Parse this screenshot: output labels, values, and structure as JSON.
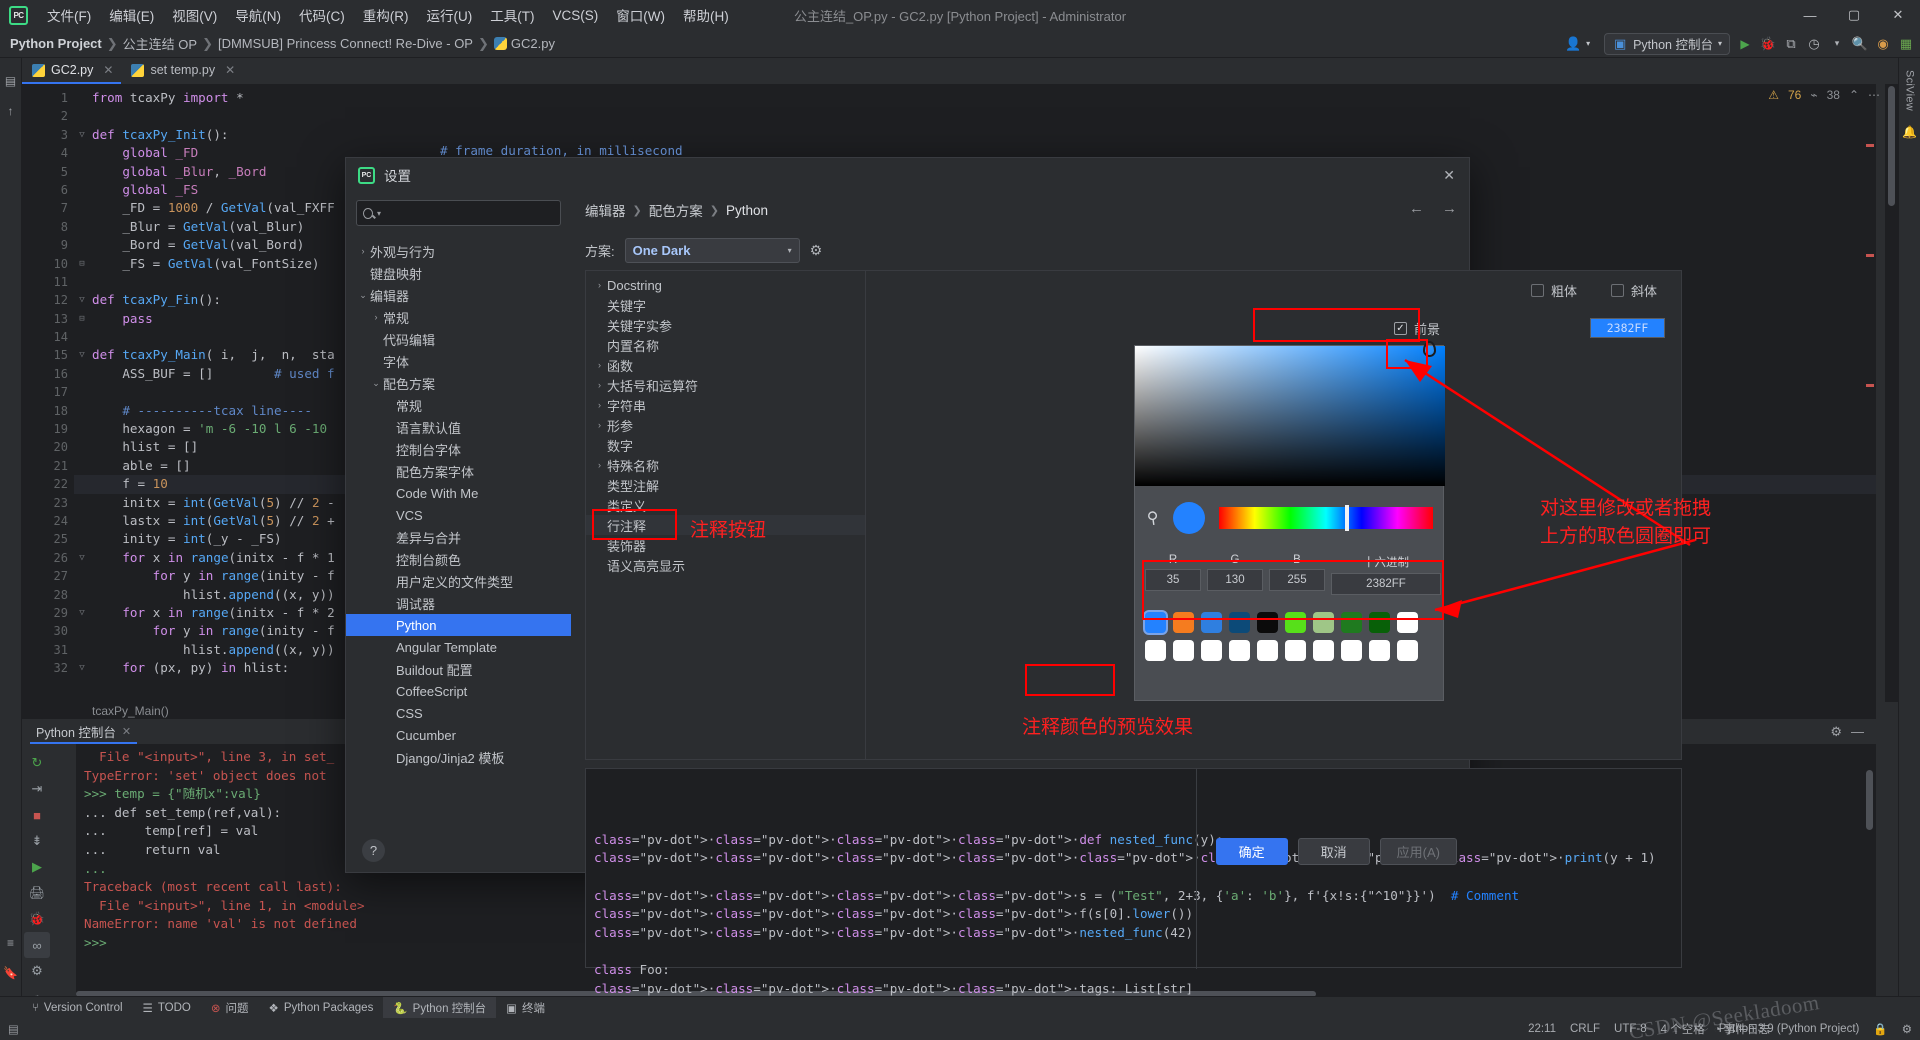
{
  "titlebar": {
    "logo": "PC",
    "menu": [
      "文件(F)",
      "编辑(E)",
      "视图(V)",
      "导航(N)",
      "代码(C)",
      "重构(R)",
      "运行(U)",
      "工具(T)",
      "VCS(S)",
      "窗口(W)",
      "帮助(H)"
    ],
    "window_title": "公主连结_OP.py - GC2.py [Python Project] - Administrator",
    "minimize": "—",
    "maximize": "▢",
    "close": "✕"
  },
  "navbar": {
    "crumbs": [
      "Python Project",
      "公主连结 OP",
      "[DMMSUB] Princess Connect! Re-Dive - OP",
      "GC2.py"
    ],
    "run_config": "Python 控制台",
    "icons": [
      "user-icon",
      "git-branch-icon",
      "run-icon",
      "debug-icon",
      "coverage-icon",
      "profile-icon",
      "search-icon",
      "notification-icon",
      "more-icon"
    ]
  },
  "editor_tabs": [
    {
      "label": "GC2.py",
      "active": true
    },
    {
      "label": "set temp.py",
      "active": false
    }
  ],
  "editor": {
    "badges": {
      "warnings": "76",
      "weak": "38"
    },
    "breadcrumb": "tcaxPy_Main()",
    "lines": [
      {
        "n": 1,
        "tokens": [
          [
            "k",
            "from "
          ],
          [
            "d",
            "tcaxPy "
          ],
          [
            "k",
            "import "
          ],
          [
            "d",
            "*"
          ]
        ]
      },
      {
        "n": 2,
        "tokens": []
      },
      {
        "n": 3,
        "fold": "▽",
        "tokens": [
          [
            "k",
            "def "
          ],
          [
            "fn",
            "tcaxPy_Init"
          ],
          [
            "d",
            "():"
          ]
        ]
      },
      {
        "n": 4,
        "tokens": [
          [
            "d",
            "    "
          ],
          [
            "k",
            "global "
          ],
          [
            "g",
            "_FD"
          ]
        ]
      },
      {
        "n": 5,
        "tokens": [
          [
            "d",
            "    "
          ],
          [
            "k",
            "global "
          ],
          [
            "g",
            "_Blur"
          ],
          [
            "d",
            ", "
          ],
          [
            "g",
            "_Bord"
          ]
        ]
      },
      {
        "n": 6,
        "tokens": [
          [
            "d",
            "    "
          ],
          [
            "k",
            "global "
          ],
          [
            "g",
            "_FS"
          ]
        ]
      },
      {
        "n": 7,
        "tokens": [
          [
            "d",
            "    _FD = "
          ],
          [
            "n",
            "1000"
          ],
          [
            "d",
            " / "
          ],
          [
            "fn",
            "GetVal"
          ],
          [
            "d",
            "(val_FXFF"
          ]
        ]
      },
      {
        "n": 8,
        "tokens": [
          [
            "d",
            "    _Blur = "
          ],
          [
            "fn",
            "GetVal"
          ],
          [
            "d",
            "(val_Blur)"
          ]
        ]
      },
      {
        "n": 9,
        "tokens": [
          [
            "d",
            "    _Bord = "
          ],
          [
            "fn",
            "GetVal"
          ],
          [
            "d",
            "(val_Bord)"
          ]
        ]
      },
      {
        "n": 10,
        "fold": "⊟",
        "tokens": [
          [
            "d",
            "    _FS = "
          ],
          [
            "fn",
            "GetVal"
          ],
          [
            "d",
            "(val_FontSize)"
          ]
        ]
      },
      {
        "n": 11,
        "tokens": []
      },
      {
        "n": 12,
        "fold": "▽",
        "tokens": [
          [
            "k",
            "def "
          ],
          [
            "fn",
            "tcaxPy_Fin"
          ],
          [
            "d",
            "():"
          ]
        ]
      },
      {
        "n": 13,
        "fold": "⊟",
        "tokens": [
          [
            "d",
            "    "
          ],
          [
            "k",
            "pass"
          ]
        ]
      },
      {
        "n": 14,
        "tokens": []
      },
      {
        "n": 15,
        "fold": "▽",
        "tokens": [
          [
            "k",
            "def "
          ],
          [
            "fn",
            "tcaxPy_Main"
          ],
          [
            "d",
            "( i,  j,  n,  sta"
          ]
        ]
      },
      {
        "n": 16,
        "tokens": [
          [
            "d",
            "    ASS_BUF = []        "
          ],
          [
            "c",
            "# used f"
          ]
        ]
      },
      {
        "n": 17,
        "tokens": []
      },
      {
        "n": 18,
        "tokens": [
          [
            "d",
            "    "
          ],
          [
            "c",
            "# ----------tcax line----"
          ]
        ]
      },
      {
        "n": 19,
        "tokens": [
          [
            "d",
            "    hexagon = "
          ],
          [
            "s",
            "'m -6 -10 l 6 -10"
          ]
        ]
      },
      {
        "n": 20,
        "tokens": [
          [
            "d",
            "    hlist = []"
          ]
        ]
      },
      {
        "n": 21,
        "tokens": [
          [
            "d",
            "    able = []"
          ]
        ]
      },
      {
        "n": 22,
        "highlight": true,
        "tokens": [
          [
            "d",
            "    f = "
          ],
          [
            "n",
            "10"
          ]
        ]
      },
      {
        "n": 23,
        "tokens": [
          [
            "d",
            "    initx = "
          ],
          [
            "fn",
            "int"
          ],
          [
            "d",
            "("
          ],
          [
            "fn",
            "GetVal"
          ],
          [
            "d",
            "("
          ],
          [
            "n",
            "5"
          ],
          [
            "d",
            ") // "
          ],
          [
            "n",
            "2"
          ],
          [
            "d",
            " -"
          ]
        ]
      },
      {
        "n": 24,
        "tokens": [
          [
            "d",
            "    lastx = "
          ],
          [
            "fn",
            "int"
          ],
          [
            "d",
            "("
          ],
          [
            "fn",
            "GetVal"
          ],
          [
            "d",
            "("
          ],
          [
            "n",
            "5"
          ],
          [
            "d",
            ") // "
          ],
          [
            "n",
            "2"
          ],
          [
            "d",
            " +"
          ]
        ]
      },
      {
        "n": 25,
        "tokens": [
          [
            "d",
            "    inity = "
          ],
          [
            "fn",
            "int"
          ],
          [
            "d",
            "(_y - _FS)"
          ]
        ]
      },
      {
        "n": 26,
        "fold": "▽",
        "tokens": [
          [
            "d",
            "    "
          ],
          [
            "k",
            "for "
          ],
          [
            "d",
            "x "
          ],
          [
            "k",
            "in "
          ],
          [
            "fn",
            "range"
          ],
          [
            "d",
            "(initx - f * 1"
          ]
        ]
      },
      {
        "n": 27,
        "tokens": [
          [
            "d",
            "        "
          ],
          [
            "k",
            "for "
          ],
          [
            "d",
            "y "
          ],
          [
            "k",
            "in "
          ],
          [
            "fn",
            "range"
          ],
          [
            "d",
            "(inity - f"
          ]
        ]
      },
      {
        "n": 28,
        "tokens": [
          [
            "d",
            "            hlist."
          ],
          [
            "fn",
            "append"
          ],
          [
            "d",
            "((x, y))"
          ]
        ]
      },
      {
        "n": 29,
        "fold": "▽",
        "tokens": [
          [
            "d",
            "    "
          ],
          [
            "k",
            "for "
          ],
          [
            "d",
            "x "
          ],
          [
            "k",
            "in "
          ],
          [
            "fn",
            "range"
          ],
          [
            "d",
            "(initx - f * 2"
          ]
        ]
      },
      {
        "n": 30,
        "tokens": [
          [
            "d",
            "        "
          ],
          [
            "k",
            "for "
          ],
          [
            "d",
            "y "
          ],
          [
            "k",
            "in "
          ],
          [
            "fn",
            "range"
          ],
          [
            "d",
            "(inity - f"
          ]
        ]
      },
      {
        "n": 31,
        "tokens": [
          [
            "d",
            "            hlist."
          ],
          [
            "fn",
            "append"
          ],
          [
            "d",
            "((x, y))"
          ]
        ]
      },
      {
        "n": 32,
        "fold": "▽",
        "tokens": [
          [
            "d",
            "    "
          ],
          [
            "k",
            "for "
          ],
          [
            "d",
            "(px, py) "
          ],
          [
            "k",
            "in "
          ],
          [
            "d",
            "hlist:"
          ]
        ]
      }
    ],
    "overlay_comment": "# frame duration, in millisecond"
  },
  "console": {
    "tab_label": "Python 控制台",
    "close": "✕",
    "icons": [
      "rerun-icon",
      "stop-icon",
      "run-icon",
      "debug-icon",
      "settings-icon",
      "add-icon",
      "soft-wrap-icon",
      "scroll-end-icon",
      "print-icon",
      "show-variables-icon",
      "history-icon"
    ],
    "lines": [
      {
        "cls": "co-err",
        "text": "  File \"<input>\", line 3, in set_"
      },
      {
        "cls": "co-err",
        "text": "TypeError: 'set' object does not"
      },
      {
        "cls": "co-prompt",
        "text": ">>> temp = {\"随机x\":val}"
      },
      {
        "cls": "co-mix1",
        "text": "... def set_temp(ref,val):"
      },
      {
        "cls": "co-mix2",
        "text": "...     temp[ref] = val"
      },
      {
        "cls": "co-mix3",
        "text": "...     return val"
      },
      {
        "cls": "co-dots",
        "text": "..."
      },
      {
        "cls": "co-err",
        "text": "Traceback (most recent call last):"
      },
      {
        "cls": "co-err",
        "text": "  File \"<input>\", line 1, in <module>"
      },
      {
        "cls": "co-err",
        "text": "NameError: name 'val' is not defined"
      },
      {
        "cls": "co-prompt",
        "text": ">>>"
      }
    ]
  },
  "toolwindow_bar": {
    "items": [
      {
        "label": "Version Control",
        "icon": "branch-icon",
        "active": false
      },
      {
        "label": "TODO",
        "icon": "list-icon",
        "active": false
      },
      {
        "label": "问题",
        "icon": "error-icon",
        "active": false
      },
      {
        "label": "Python Packages",
        "icon": "packages-icon",
        "active": false
      },
      {
        "label": "Python 控制台",
        "icon": "python-icon",
        "active": true
      },
      {
        "label": "终端",
        "icon": "terminal-icon",
        "active": false
      }
    ]
  },
  "statusbar": {
    "left_icon": "memory-icon",
    "right": [
      "22:11",
      "CRLF",
      "UTF-8",
      "4 个空格",
      "Python 3.9 (Python Project)",
      "lock-icon",
      "settings-icon"
    ],
    "event_log": "事件日志"
  },
  "watermark": "CSDN @Seekladoom",
  "dialog": {
    "title": "设置",
    "logo": "PC",
    "close": "✕",
    "search_placeholder": "",
    "tree": [
      {
        "label": "外观与行为",
        "arrow": "›",
        "indent": 0,
        "selected": false
      },
      {
        "label": "键盘映射",
        "arrow": "",
        "indent": 0,
        "selected": false
      },
      {
        "label": "编辑器",
        "arrow": "⌄",
        "indent": 0,
        "selected": false
      },
      {
        "label": "常规",
        "arrow": "›",
        "indent": 1,
        "selected": false
      },
      {
        "label": "代码编辑",
        "arrow": "",
        "indent": 1,
        "selected": false
      },
      {
        "label": "字体",
        "arrow": "",
        "indent": 1,
        "selected": false
      },
      {
        "label": "配色方案",
        "arrow": "⌄",
        "indent": 1,
        "selected": false
      },
      {
        "label": "常规",
        "arrow": "",
        "indent": 2,
        "selected": false
      },
      {
        "label": "语言默认值",
        "arrow": "",
        "indent": 2,
        "selected": false
      },
      {
        "label": "控制台字体",
        "arrow": "",
        "indent": 2,
        "selected": false
      },
      {
        "label": "配色方案字体",
        "arrow": "",
        "indent": 2,
        "selected": false
      },
      {
        "label": "Code With Me",
        "arrow": "",
        "indent": 2,
        "selected": false
      },
      {
        "label": "VCS",
        "arrow": "",
        "indent": 2,
        "selected": false
      },
      {
        "label": "差异与合并",
        "arrow": "",
        "indent": 2,
        "selected": false
      },
      {
        "label": "控制台颜色",
        "arrow": "",
        "indent": 2,
        "selected": false
      },
      {
        "label": "用户定义的文件类型",
        "arrow": "",
        "indent": 2,
        "selected": false
      },
      {
        "label": "调试器",
        "arrow": "",
        "indent": 2,
        "selected": false
      },
      {
        "label": "Python",
        "arrow": "",
        "indent": 2,
        "selected": true
      },
      {
        "label": "Angular Template",
        "arrow": "",
        "indent": 2,
        "selected": false
      },
      {
        "label": "Buildout 配置",
        "arrow": "",
        "indent": 2,
        "selected": false
      },
      {
        "label": "CoffeeScript",
        "arrow": "",
        "indent": 2,
        "selected": false
      },
      {
        "label": "CSS",
        "arrow": "",
        "indent": 2,
        "selected": false
      },
      {
        "label": "Cucumber",
        "arrow": "",
        "indent": 2,
        "selected": false
      },
      {
        "label": "Django/Jinja2 模板",
        "arrow": "",
        "indent": 2,
        "selected": false
      }
    ],
    "breadcrumb": [
      "编辑器",
      "配色方案",
      "Python"
    ],
    "nav_back": "←",
    "nav_fwd": "→",
    "scheme_label": "方案:",
    "scheme_value": "One Dark",
    "gear_icon": "gear-icon",
    "elements": [
      {
        "label": "Docstring",
        "arrow": "›"
      },
      {
        "label": "关键字",
        "arrow": ""
      },
      {
        "label": "关键字实参",
        "arrow": ""
      },
      {
        "label": "内置名称",
        "arrow": ""
      },
      {
        "label": "函数",
        "arrow": "›"
      },
      {
        "label": "大括号和运算符",
        "arrow": "›"
      },
      {
        "label": "字符串",
        "arrow": "›"
      },
      {
        "label": "形参",
        "arrow": "›"
      },
      {
        "label": "数字",
        "arrow": ""
      },
      {
        "label": "特殊名称",
        "arrow": "›"
      },
      {
        "label": "类型注解",
        "arrow": ""
      },
      {
        "label": "类定义",
        "arrow": ""
      },
      {
        "label": "行注释",
        "arrow": "",
        "selected": true
      },
      {
        "label": "装饰器",
        "arrow": ""
      },
      {
        "label": "语义高亮显示",
        "arrow": ""
      }
    ],
    "attributes": {
      "bold_label": "粗体",
      "italic_label": "斜体",
      "foreground_label": "前景",
      "foreground_value": "2382FF",
      "bold_checked": false,
      "italic_checked": false,
      "foreground_checked": true
    },
    "preview_lines": [
      "····def nested_func(y):",
      "········print(y + 1)",
      "",
      "····s = (\"Test\", 2+3, {'a': 'b'}, f'{x!s:{\"^10\"}}')  # Comment",
      "····f(s[0].lower())",
      "····nested_func(42)",
      "",
      "class Foo:",
      "····tags: List[str]"
    ],
    "preview_comment": "# Comment",
    "buttons": {
      "ok": "确定",
      "cancel": "取消",
      "apply": "应用(A)",
      "help": "?"
    }
  },
  "picker": {
    "eyedropper_icon": "eyedropper-icon",
    "current_color": "#2382FF",
    "labels": {
      "r": "R",
      "g": "G",
      "b": "B",
      "hex": "十六进制"
    },
    "values": {
      "r": "35",
      "g": "130",
      "b": "255",
      "hex": "2382FF"
    },
    "swatches_row1": [
      "#2382FF",
      "#F57C1F",
      "#2F7FE0",
      "#0C4A78",
      "#0B0B0B",
      "#57E01A",
      "#9FC687",
      "#1F7A1F",
      "#086008",
      "#FFFFFF"
    ],
    "swatches_row2": [
      "#FFFFFF",
      "#FFFFFF",
      "#FFFFFF",
      "#FFFFFF",
      "#FFFFFF",
      "#FFFFFF",
      "#FFFFFF",
      "#FFFFFF",
      "#FFFFFF",
      "#FFFFFF"
    ]
  },
  "annotations": {
    "comment_button": "注释按钮",
    "drag_hint_line1": "对这里修改或者拖拽",
    "drag_hint_line2": "上方的取色圆圈即可",
    "preview_hint": "注释颜色的预览效果"
  },
  "colors": {
    "accent": "#3574f0",
    "picked": "#2382FF",
    "annotation_red": "#ff0000",
    "editor_bg": "#1e1f22",
    "panel_bg": "#2b2d30"
  }
}
